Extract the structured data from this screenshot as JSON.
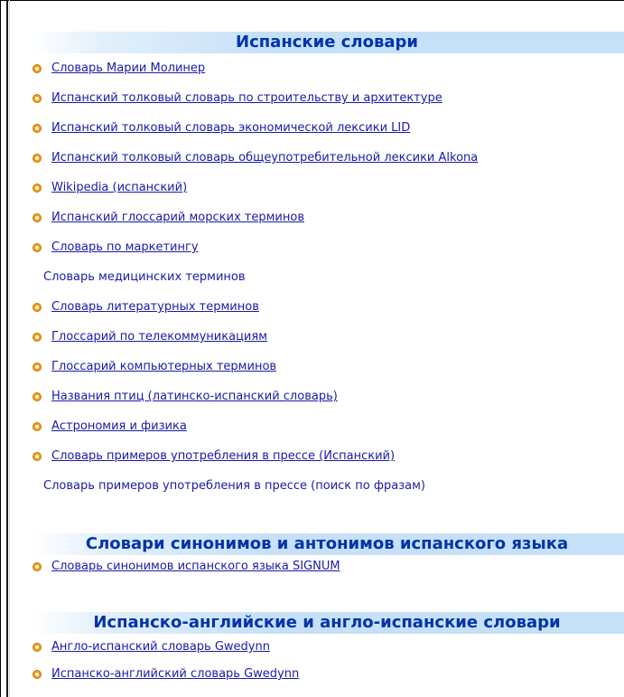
{
  "sections": [
    {
      "title": "Испанские словари",
      "items": [
        {
          "label": "Словарь Марии Молинер",
          "link": true
        },
        {
          "label": "Испанский толковый словарь по строительству и архитектуре",
          "link": true
        },
        {
          "label": "Испанский толковый словарь экономической лексики LID",
          "link": true
        },
        {
          "label": "Испанский толковый словарь общеупотребительной лексики Alkona",
          "link": true
        },
        {
          "label": "Wikipedia (испанский)",
          "link": true
        },
        {
          "label": "Испанский глоссарий морских терминов",
          "link": true
        },
        {
          "label": "Словарь по маркетингу",
          "link": true
        },
        {
          "label": "Словарь медицинских терминов",
          "link": false
        },
        {
          "label": "Словарь литературных терминов",
          "link": true
        },
        {
          "label": "Глоссарий по телекоммуникациям",
          "link": true
        },
        {
          "label": "Глоссарий компьютерных терминов",
          "link": true
        },
        {
          "label": "Названия птиц (латинско-испанский словарь)",
          "link": true
        },
        {
          "label": "Астрономия и физика",
          "link": true
        },
        {
          "label": "Словарь примеров употребления в прессе (Испанский)",
          "link": true
        },
        {
          "label": "Словарь примеров употребления в прессе (поиск по фразам)",
          "link": false
        }
      ]
    },
    {
      "title": "Словари синонимов и антонимов испанского языка",
      "items": [
        {
          "label": "Словарь синонимов испанского языка SIGNUM",
          "link": true
        }
      ]
    },
    {
      "title": "Испанско-английские и англо-испанские словари",
      "items": [
        {
          "label": "Англо-испанский словарь Gwedynn",
          "link": true
        },
        {
          "label": "Испанско-английский словарь Gwedynn",
          "link": true
        }
      ]
    }
  ]
}
